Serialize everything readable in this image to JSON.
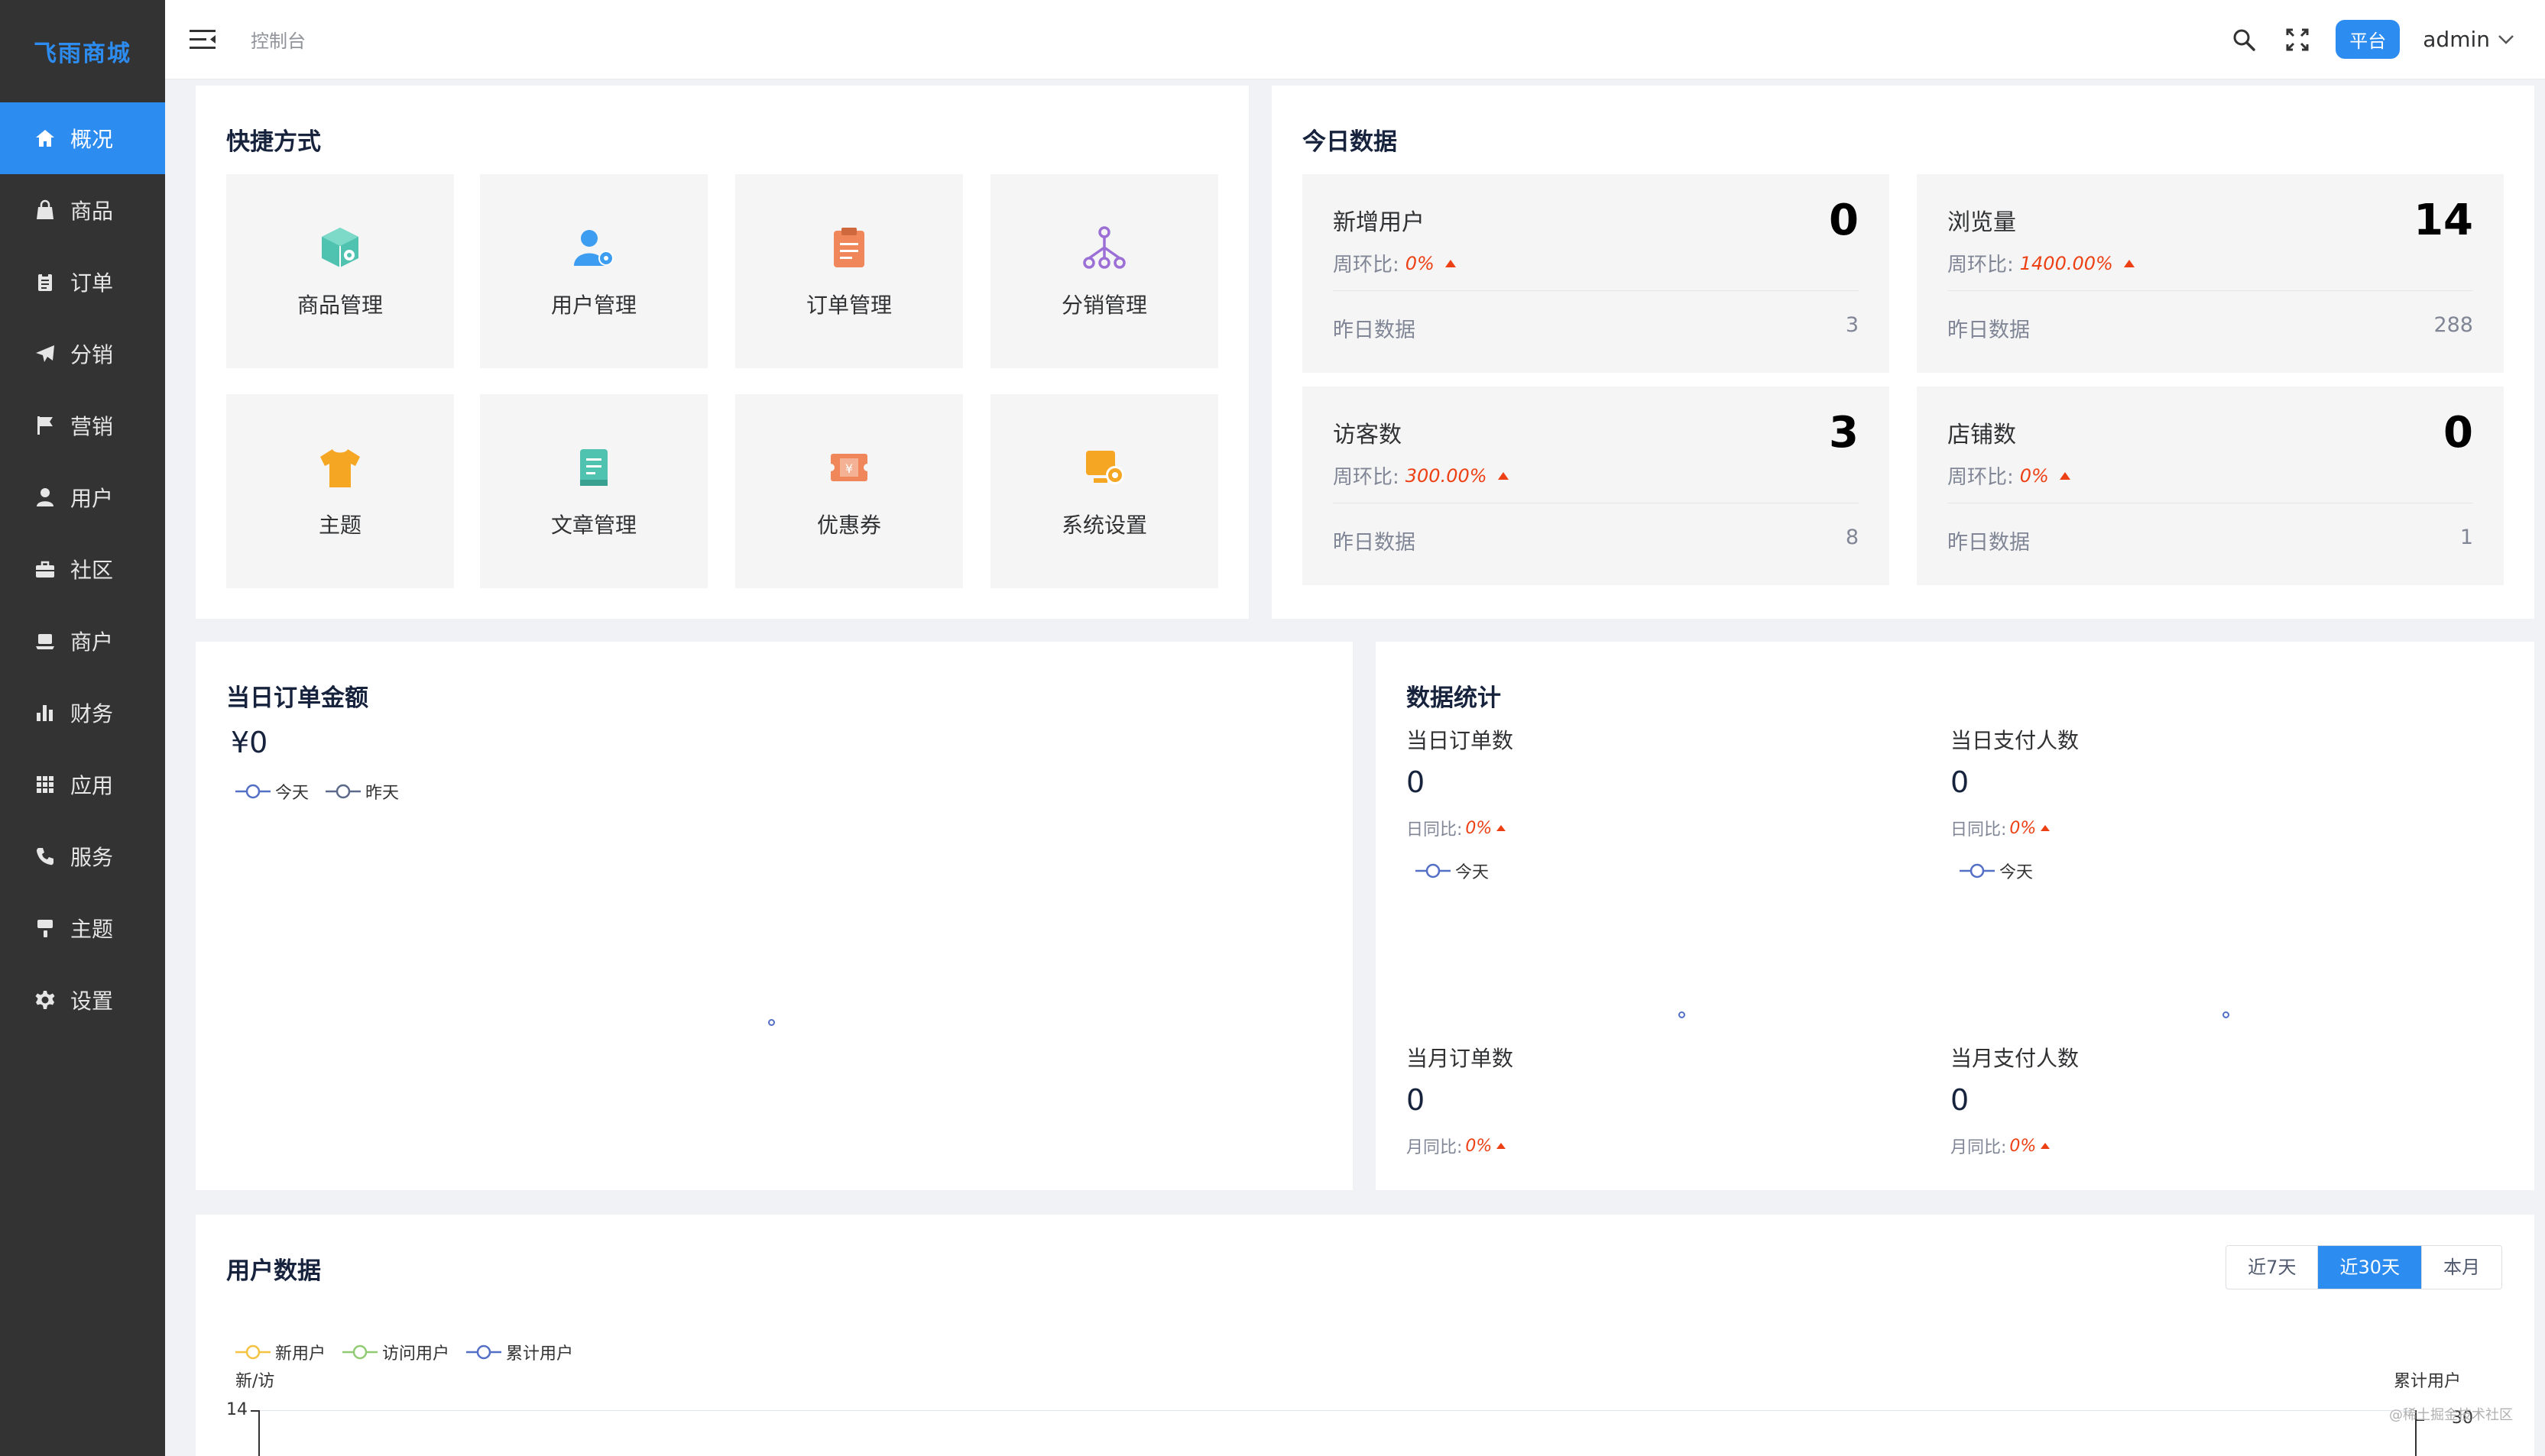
{
  "app": {
    "logo": "飞雨商城"
  },
  "sidebar": {
    "items": [
      {
        "label": "概况",
        "icon": "home-icon",
        "active": true
      },
      {
        "label": "商品",
        "icon": "bag-icon"
      },
      {
        "label": "订单",
        "icon": "clipboard-icon"
      },
      {
        "label": "分销",
        "icon": "send-icon"
      },
      {
        "label": "营销",
        "icon": "flag-icon"
      },
      {
        "label": "用户",
        "icon": "user-icon"
      },
      {
        "label": "社区",
        "icon": "briefcase-icon"
      },
      {
        "label": "商户",
        "icon": "laptop-icon"
      },
      {
        "label": "财务",
        "icon": "bar-chart-icon"
      },
      {
        "label": "应用",
        "icon": "grid-icon"
      },
      {
        "label": "服务",
        "icon": "phone-icon"
      },
      {
        "label": "主题",
        "icon": "brush-icon"
      },
      {
        "label": "设置",
        "icon": "gear-icon"
      }
    ]
  },
  "header": {
    "breadcrumb": "控制台",
    "platform_badge": "平台",
    "user": "admin"
  },
  "quick": {
    "title": "快捷方式",
    "items": [
      {
        "label": "商品管理",
        "icon": "cube-icon",
        "color": "#4fc3b0"
      },
      {
        "label": "用户管理",
        "icon": "user-settings-icon",
        "color": "#3d9df0"
      },
      {
        "label": "订单管理",
        "icon": "order-clipboard-icon",
        "color": "#f0875a"
      },
      {
        "label": "分销管理",
        "icon": "network-icon",
        "color": "#9b6fd6"
      },
      {
        "label": "主题",
        "icon": "tshirt-icon",
        "color": "#f5a623"
      },
      {
        "label": "文章管理",
        "icon": "article-icon",
        "color": "#4fc3b0"
      },
      {
        "label": "优惠券",
        "icon": "coupon-icon",
        "color": "#f0875a"
      },
      {
        "label": "系统设置",
        "icon": "system-settings-icon",
        "color": "#f5a623"
      }
    ]
  },
  "today": {
    "title": "今日数据",
    "ratio_label": "周环比:",
    "yesterday_label": "昨日数据",
    "stats": [
      {
        "title": "新增用户",
        "value": "0",
        "ratio": "0%",
        "yesterday": "3"
      },
      {
        "title": "浏览量",
        "value": "14",
        "ratio": "1400.00%",
        "yesterday": "288"
      },
      {
        "title": "访客数",
        "value": "3",
        "ratio": "300.00%",
        "yesterday": "8"
      },
      {
        "title": "店铺数",
        "value": "0",
        "ratio": "0%",
        "yesterday": "1"
      }
    ]
  },
  "order_amount": {
    "title": "当日订单金额",
    "amount": "¥0",
    "legend_today": "今天",
    "legend_yesterday": "昨天"
  },
  "data_stats": {
    "title": "数据统计",
    "legend_today": "今天",
    "cells": [
      {
        "label": "当日订单数",
        "value": "0",
        "ratio_label": "日同比:",
        "ratio": "0%"
      },
      {
        "label": "当日支付人数",
        "value": "0",
        "ratio_label": "日同比:",
        "ratio": "0%"
      },
      {
        "label": "当月订单数",
        "value": "0",
        "ratio_label": "月同比:",
        "ratio": "0%"
      },
      {
        "label": "当月支付人数",
        "value": "0",
        "ratio_label": "月同比:",
        "ratio": "0%"
      }
    ]
  },
  "user_data": {
    "title": "用户数据",
    "ranges": [
      "近7天",
      "近30天",
      "本月"
    ],
    "selected_range": "近30天",
    "legend": [
      {
        "name": "新用户",
        "color": "#f5c342"
      },
      {
        "name": "访问用户",
        "color": "#91cc75"
      },
      {
        "name": "累计用户",
        "color": "#5470c6"
      }
    ],
    "left_axis_label": "新/访",
    "right_axis_label": "累计用户",
    "left_axis_max": "14",
    "right_axis_max": "30"
  },
  "watermark": "@稀土掘金技术社区"
}
